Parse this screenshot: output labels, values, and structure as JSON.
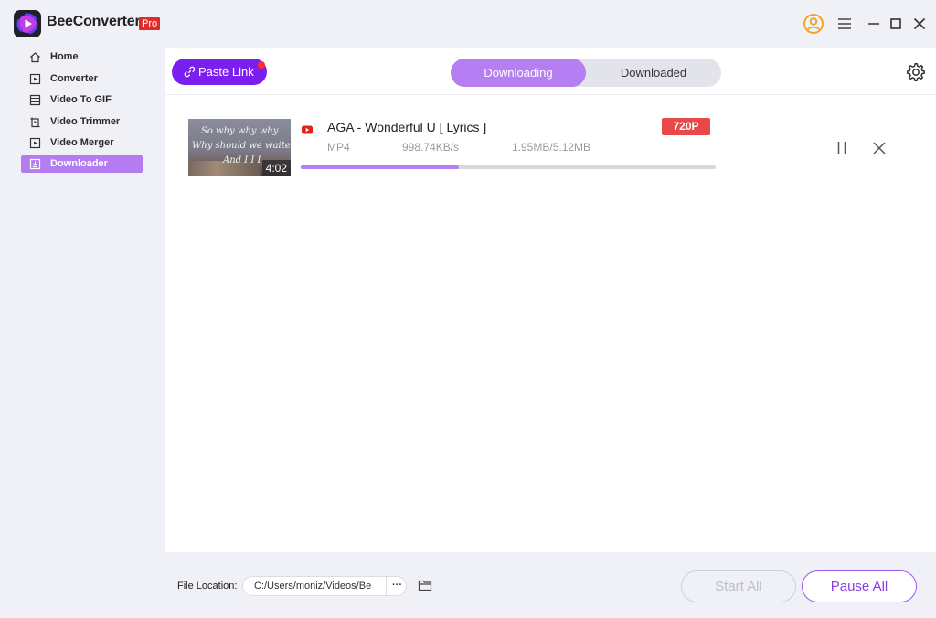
{
  "app": {
    "name": "BeeConverter",
    "badge": "Pro",
    "icons": [
      "app-logo-icon",
      "user-icon",
      "menu-icon",
      "minimize-icon",
      "maximize-icon",
      "close-icon"
    ]
  },
  "sidebar": {
    "items": [
      {
        "label": "Home",
        "icon": "home-icon",
        "active": false
      },
      {
        "label": "Converter",
        "icon": "converter-icon",
        "active": false
      },
      {
        "label": "Video To GIF",
        "icon": "gif-icon",
        "active": false
      },
      {
        "label": "Video Trimmer",
        "icon": "trimmer-icon",
        "active": false
      },
      {
        "label": "Video Merger",
        "icon": "merger-icon",
        "active": false
      },
      {
        "label": "Downloader",
        "icon": "download-icon",
        "active": true
      }
    ]
  },
  "toolbar": {
    "paste_label": "Paste Link",
    "tabs": [
      {
        "label": "Downloading",
        "active": true
      },
      {
        "label": "Downloaded",
        "active": false
      }
    ]
  },
  "download": {
    "thumbnail_lines": [
      "So why why why",
      "Why should we waited",
      "And I I I"
    ],
    "duration": "4:02",
    "source_icon": "youtube-icon",
    "title": "AGA - Wonderful U [ Lyrics ]",
    "quality": "720P",
    "format": "MP4",
    "speed": "998.74KB/s",
    "size": "1.95MB/5.12MB",
    "progress_percent": 38
  },
  "footer": {
    "location_label": "File Location:",
    "location_value": "C:/Users/moniz/Videos/BeeConverter",
    "more_label": "···",
    "start_all_label": "Start All",
    "pause_all_label": "Pause All"
  },
  "colors": {
    "accent": "#b57ef2",
    "paste_button": "#7a1ff0",
    "pro_badge": "#e02b2b",
    "quality_badge": "#e84848"
  }
}
